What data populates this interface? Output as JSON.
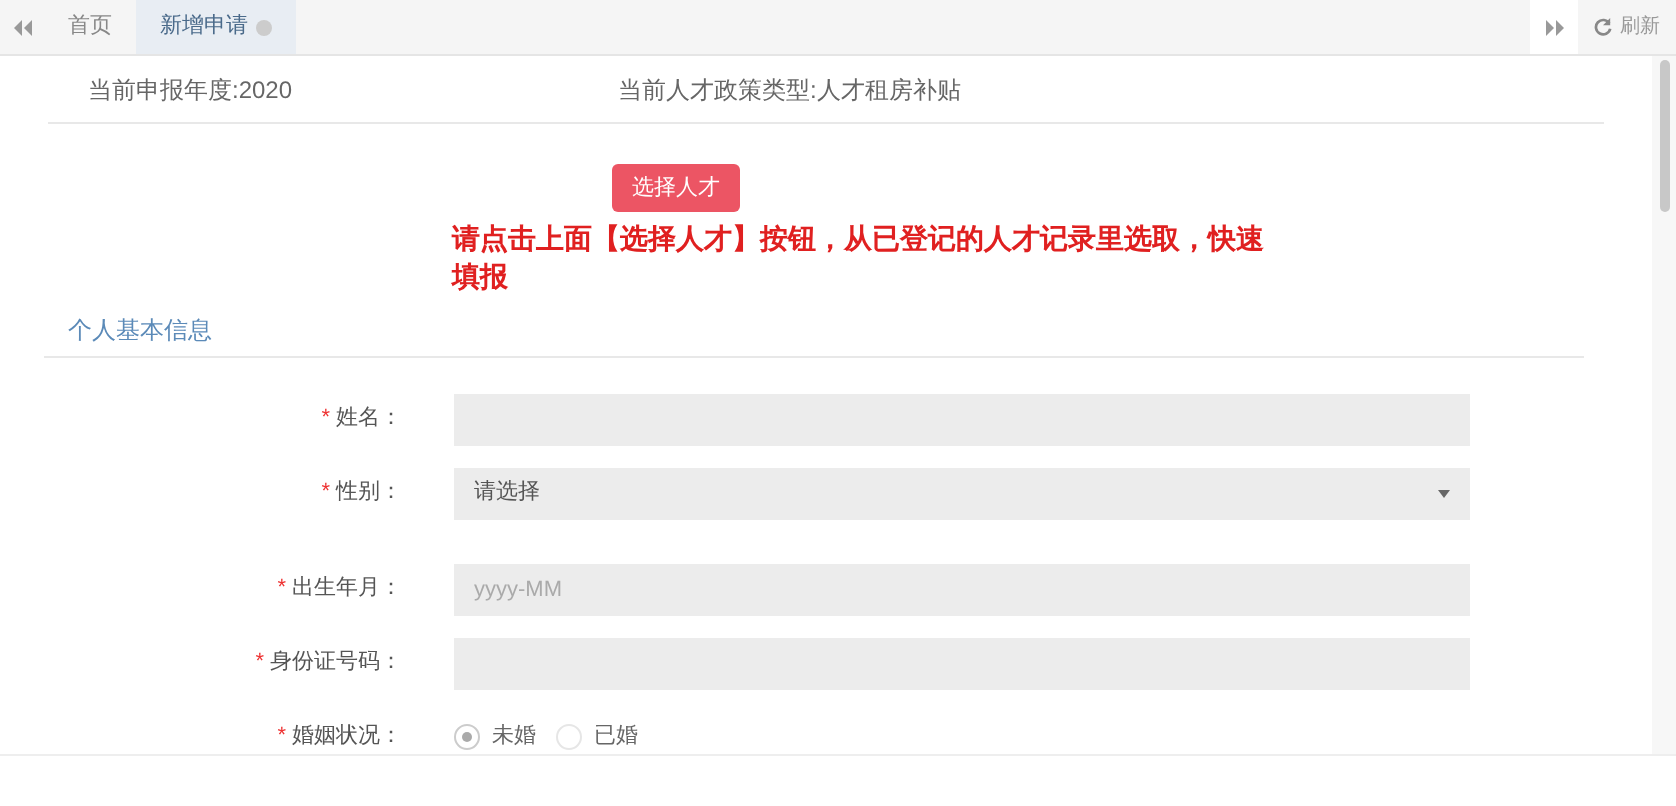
{
  "tabs": [
    {
      "label": "首页",
      "selected": false,
      "closable": false
    },
    {
      "label": "新增申请",
      "selected": true,
      "closable": true
    }
  ],
  "refresh": {
    "label": "刷新"
  },
  "header": {
    "year": "当前申报年度:2020",
    "policy": "当前人才政策类型:人才租房补贴"
  },
  "select_button": {
    "label": "选择人才"
  },
  "notice": "请点击上面【选择人才】按钮，从已登记的人才记录里选取，快速填报",
  "section_title": "个人基本信息",
  "fields": [
    {
      "kind": "text",
      "label": "姓名：",
      "required_mark": "*"
    },
    {
      "kind": "select",
      "label": "性别：",
      "required_mark": "*",
      "value": "请选择"
    },
    {
      "kind": "text",
      "label": "出生年月：",
      "required_mark": "*",
      "placeholder": "yyyy-MM"
    },
    {
      "kind": "text",
      "label": "身份证号码：",
      "required_mark": "*"
    },
    {
      "kind": "radio",
      "label": "婚姻状况：",
      "required_mark": "*",
      "options": [
        {
          "label": "未婚",
          "selected": true
        },
        {
          "label": "已婚",
          "selected": false
        }
      ]
    }
  ]
}
